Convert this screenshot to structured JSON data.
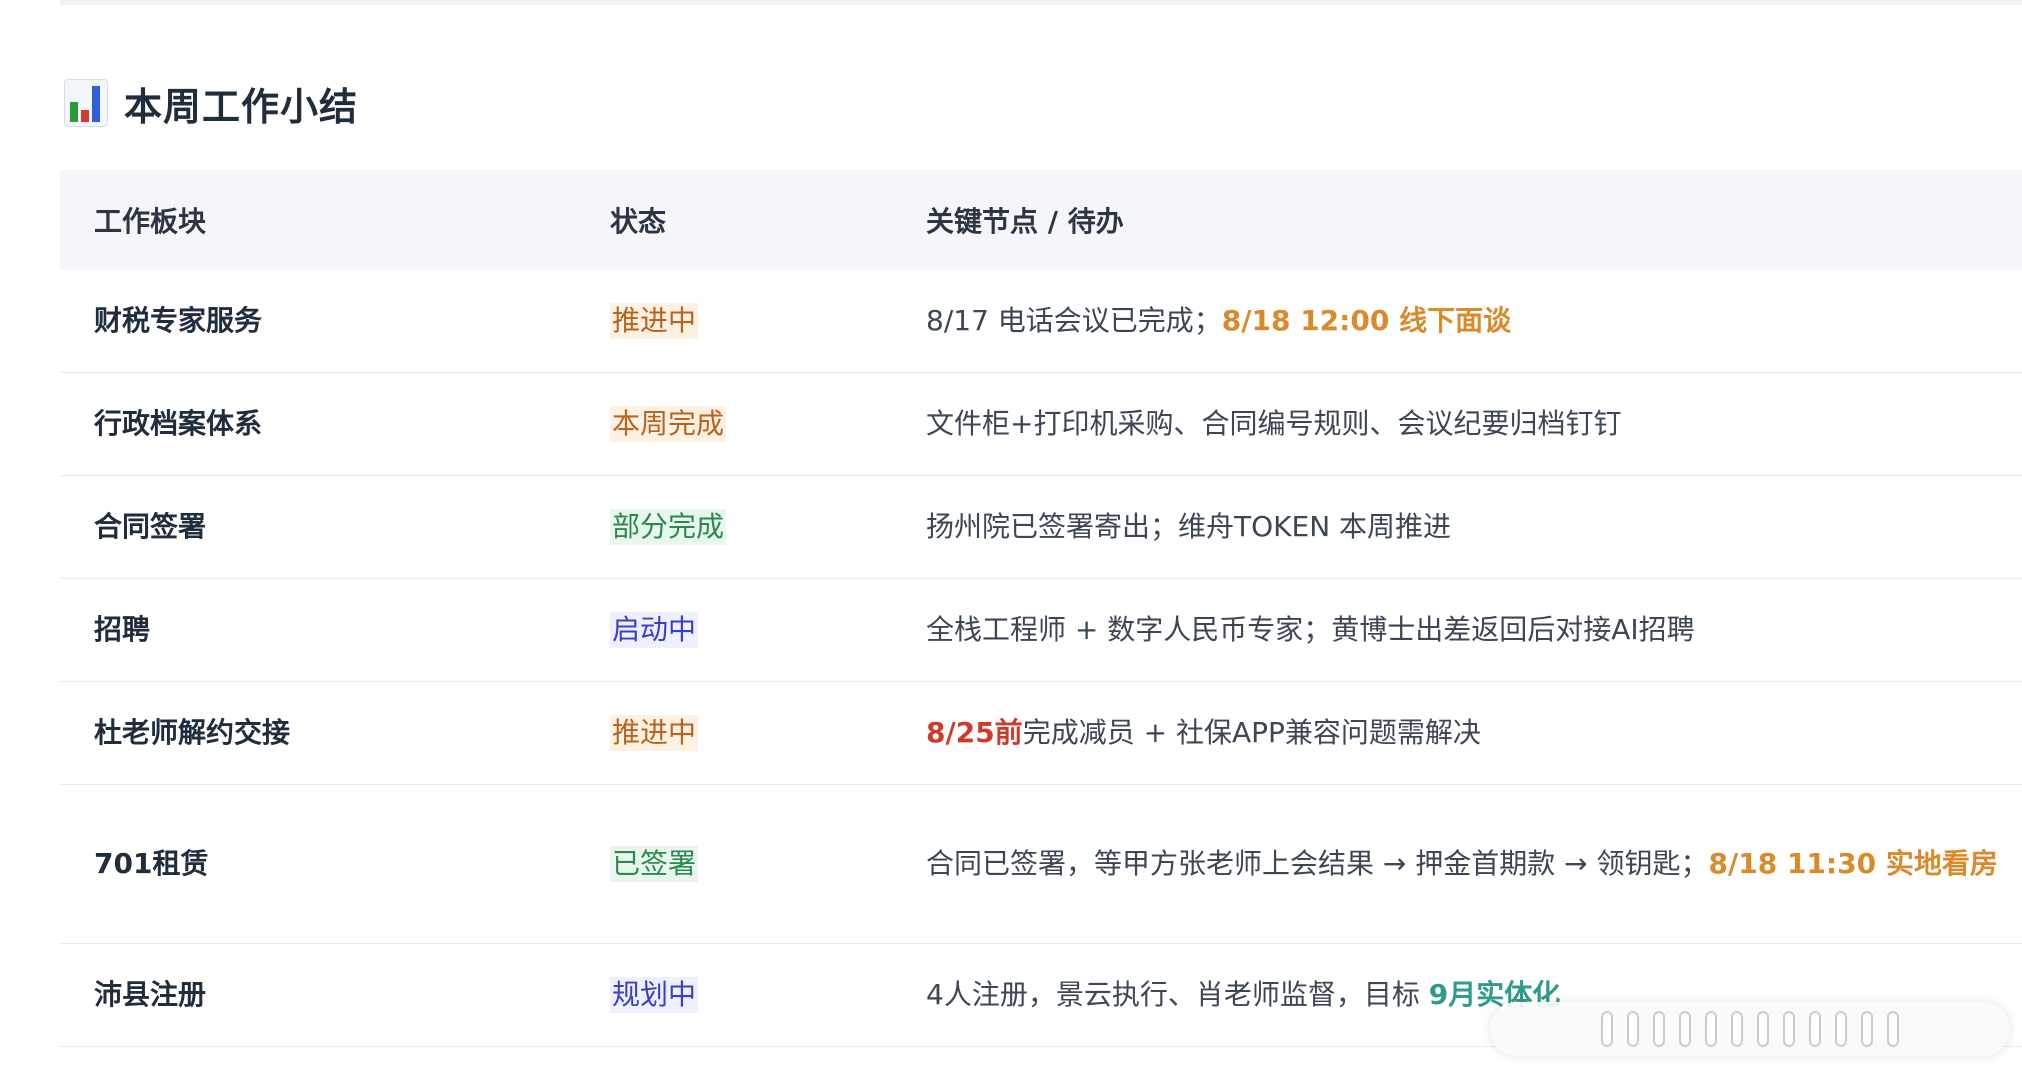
{
  "section": {
    "icon": "bar-chart-icon",
    "title": "本周工作小结"
  },
  "table": {
    "headers": [
      "工作板块",
      "状态",
      "关键节点 / 待办"
    ],
    "rows": [
      {
        "area": "财税专家服务",
        "status": "推进中",
        "status_color": "orange",
        "note_parts": [
          {
            "text": "8/17 电话会议已完成；",
            "style": "normal"
          },
          {
            "text": "8/18 12:00 线下面谈",
            "style": "orange"
          }
        ]
      },
      {
        "area": "行政档案体系",
        "status": "本周完成",
        "status_color": "orange",
        "note_parts": [
          {
            "text": "文件柜+打印机采购、合同编号规则、会议纪要归档钉钉",
            "style": "normal"
          }
        ]
      },
      {
        "area": "合同签署",
        "status": "部分完成",
        "status_color": "green",
        "note_parts": [
          {
            "text": "扬州院已签署寄出；维舟TOKEN 本周推进",
            "style": "normal"
          }
        ]
      },
      {
        "area": "招聘",
        "status": "启动中",
        "status_color": "blue",
        "note_parts": [
          {
            "text": "全栈工程师 + 数字人民币专家；黄博士出差返回后对接AI招聘",
            "style": "normal"
          }
        ]
      },
      {
        "area": "杜老师解约交接",
        "status": "推进中",
        "status_color": "orange",
        "note_parts": [
          {
            "text": "8/25前",
            "style": "red"
          },
          {
            "text": "完成减员 + 社保APP兼容问题需解决",
            "style": "normal"
          }
        ]
      },
      {
        "area": "701租赁",
        "status": "已签署",
        "status_color": "green",
        "note_parts": [
          {
            "text": "合同已签署，等甲方张老师上会结果 → 押金首期款 → 领钥匙；",
            "style": "normal"
          },
          {
            "text": "8/18 11:30 实地看房",
            "style": "orange"
          }
        ]
      },
      {
        "area": "沛县注册",
        "status": "规划中",
        "status_color": "blue",
        "note_parts": [
          {
            "text": "4人注册，景云执行、肖老师监督，目标 ",
            "style": "normal"
          },
          {
            "text": "9月实体化",
            "style": "teal"
          }
        ]
      }
    ]
  },
  "colors": {
    "orange": "#b8641c",
    "green": "#2a8a4d",
    "blue": "#3a3fc8",
    "highlight_orange": "#d98a2b",
    "highlight_red": "#cf3a2a",
    "highlight_teal": "#2e9c8a"
  }
}
